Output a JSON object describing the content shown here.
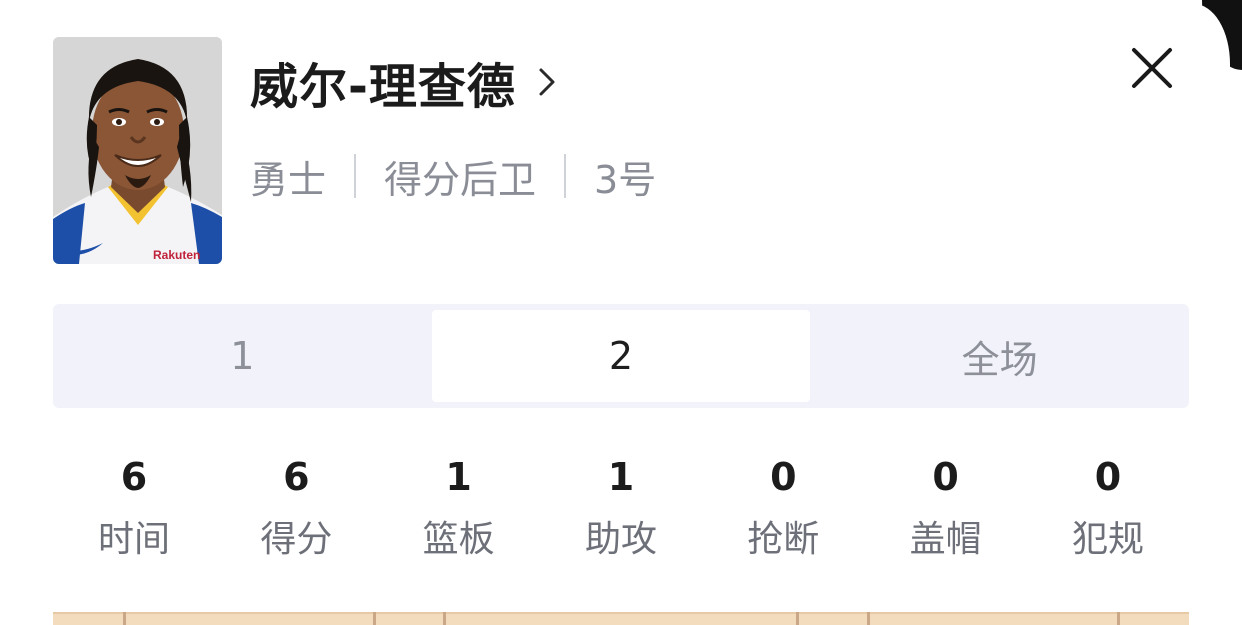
{
  "player": {
    "name": "威尔-理查德",
    "team": "勇士",
    "position": "得分后卫",
    "number": "3号",
    "jersey_text": "Rakuten"
  },
  "tabs": [
    {
      "label": "1",
      "active": false
    },
    {
      "label": "2",
      "active": true
    },
    {
      "label": "全场",
      "active": false
    }
  ],
  "stats": [
    {
      "value": "6",
      "label": "时间"
    },
    {
      "value": "6",
      "label": "得分"
    },
    {
      "value": "1",
      "label": "篮板"
    },
    {
      "value": "1",
      "label": "助攻"
    },
    {
      "value": "0",
      "label": "抢断"
    },
    {
      "value": "0",
      "label": "盖帽"
    },
    {
      "value": "0",
      "label": "犯规"
    }
  ],
  "icons": {
    "detail": "chevron-right-icon",
    "close": "close-icon"
  },
  "colors": {
    "name": "#1b1b1b",
    "meta": "#8a8d96",
    "tab_bg": "#f2f3fa",
    "court": "#f3dbbd"
  }
}
